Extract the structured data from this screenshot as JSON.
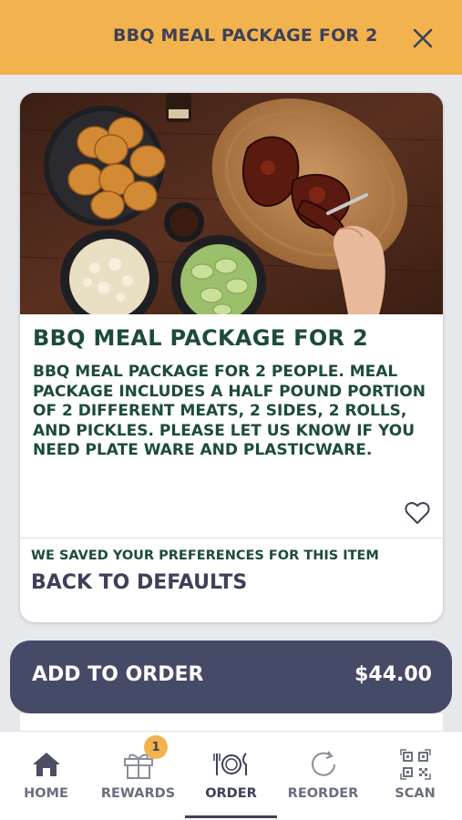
{
  "header": {
    "title": "BBQ MEAL PACKAGE FOR 2",
    "close_icon": "close-icon",
    "background_color": "#f2b24e"
  },
  "item": {
    "title": "BBQ MEAL PACKAGE FOR 2",
    "description": "BBQ MEAL PACKAGE FOR 2 PEOPLE. MEAL PACKAGE INCLUDES A HALF POUND PORTION OF 2 DIFFERENT MEATS, 2 SIDES, 2 ROLLS, AND PICKLES. PLEASE LET US KNOW IF YOU NEED PLATE WARE AND PLASTICWARE.",
    "favorite_icon": "heart-icon",
    "title_color": "#1d4b3a"
  },
  "preferences": {
    "note": "WE SAVED YOUR PREFERENCES FOR THIS ITEM",
    "reset_label": "BACK TO DEFAULTS"
  },
  "order": {
    "add_label": "ADD TO ORDER",
    "price": "$44.00",
    "button_color": "#454a66"
  },
  "nav": {
    "items": [
      {
        "label": "HOME",
        "icon": "home-icon"
      },
      {
        "label": "REWARDS",
        "icon": "gift-icon",
        "badge": "1"
      },
      {
        "label": "ORDER",
        "icon": "plate-utensils-icon",
        "active": true
      },
      {
        "label": "REORDER",
        "icon": "refresh-icon"
      },
      {
        "label": "SCAN",
        "icon": "qr-code-icon"
      }
    ]
  }
}
